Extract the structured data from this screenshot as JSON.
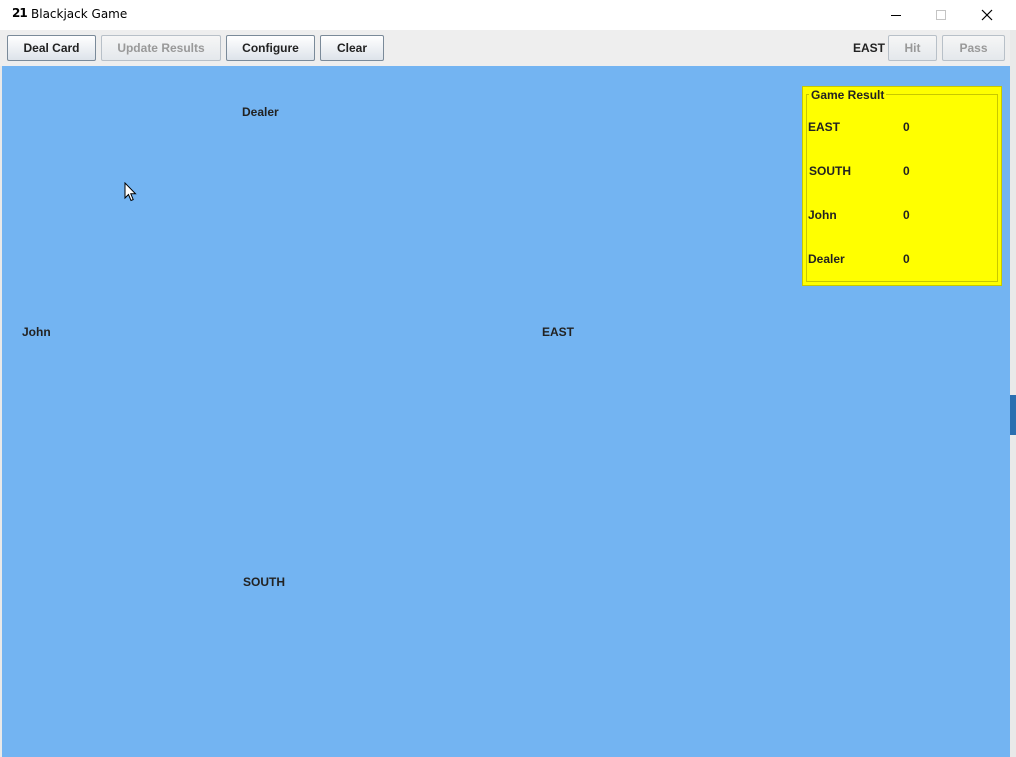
{
  "window": {
    "app_icon_text": "21",
    "title": "Blackjack Game"
  },
  "toolbar": {
    "deal_card_label": "Deal Card",
    "update_results_label": "Update Results",
    "configure_label": "Configure",
    "clear_label": "Clear",
    "current_turn": "EAST",
    "hit_label": "Hit",
    "pass_label": "Pass"
  },
  "table": {
    "background_color": "#73b4f2",
    "players": {
      "dealer": "Dealer",
      "john": "John",
      "east": "EAST",
      "south": "SOUTH"
    }
  },
  "game_result": {
    "title": "Game Result",
    "background_color": "#ffff00",
    "rows": [
      {
        "name": "EAST",
        "score": "0"
      },
      {
        "name": "SOUTH",
        "score": "0"
      },
      {
        "name": "John",
        "score": "0"
      },
      {
        "name": "Dealer",
        "score": "0"
      }
    ]
  },
  "icons": {
    "minimize": "minimize-icon",
    "maximize": "maximize-icon",
    "close": "close-icon",
    "cursor": "mouse-pointer-icon"
  }
}
